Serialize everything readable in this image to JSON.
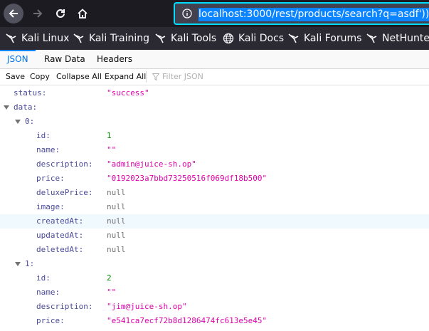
{
  "browser": {
    "url": "localhost:3000/rest/products/search?q=asdf'))",
    "bookmarks": [
      {
        "label": "Kali Linux",
        "icon": "kali-dragon-icon"
      },
      {
        "label": "Kali Training",
        "icon": "kali-dragon-icon"
      },
      {
        "label": "Kali Tools",
        "icon": "kali-dragon-icon"
      },
      {
        "label": "Kali Docs",
        "icon": "globe-icon"
      },
      {
        "label": "Kali Forums",
        "icon": "kali-dragon-icon"
      },
      {
        "label": "NetHunter",
        "icon": "kali-dragon-icon"
      }
    ]
  },
  "viewer": {
    "tabs": [
      "JSON",
      "Raw Data",
      "Headers"
    ],
    "active_tab": "JSON",
    "actions": [
      "Save",
      "Copy",
      "Collapse All",
      "Expand All"
    ],
    "filter_placeholder": "Filter JSON"
  },
  "json": {
    "status_key": "status:",
    "status_value": "\"success\"",
    "data_key": "data:",
    "items": [
      {
        "index_key": "0:",
        "fields": [
          {
            "key": "id:",
            "value": "1",
            "type": "num"
          },
          {
            "key": "name:",
            "value": "\"\"",
            "type": "str"
          },
          {
            "key": "description:",
            "value": "\"admin@juice-sh.op\"",
            "type": "str"
          },
          {
            "key": "price:",
            "value": "\"0192023a7bbd73250516f069df18b500\"",
            "type": "str"
          },
          {
            "key": "deluxePrice:",
            "value": "null",
            "type": "nul"
          },
          {
            "key": "image:",
            "value": "null",
            "type": "nul"
          },
          {
            "key": "createdAt:",
            "value": "null",
            "type": "nul"
          },
          {
            "key": "updatedAt:",
            "value": "null",
            "type": "nul"
          },
          {
            "key": "deletedAt:",
            "value": "null",
            "type": "nul"
          }
        ]
      },
      {
        "index_key": "1:",
        "fields": [
          {
            "key": "id:",
            "value": "2",
            "type": "num"
          },
          {
            "key": "name:",
            "value": "\"\"",
            "type": "str"
          },
          {
            "key": "description:",
            "value": "\"jim@juice-sh.op\"",
            "type": "str"
          },
          {
            "key": "price:",
            "value": "\"e541ca7ecf72b8d1286474fc613e5e45\"",
            "type": "str"
          }
        ]
      }
    ]
  }
}
